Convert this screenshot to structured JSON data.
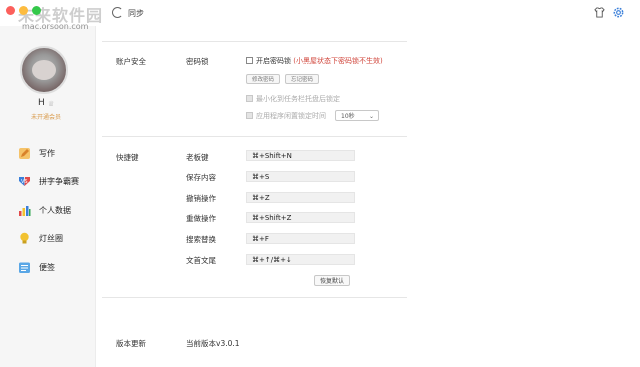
{
  "watermark": {
    "text": "未来软件园",
    "url": "mac.orsoon.com"
  },
  "topbar": {
    "sync_label": "同步"
  },
  "user": {
    "name": "H",
    "membership": "未开通会员"
  },
  "nav": [
    {
      "label": "写作",
      "color": "#e8a33a"
    },
    {
      "label": "拼字争霸赛",
      "color": "#3a7fd9"
    },
    {
      "label": "个人数据",
      "color": "#e24a4a"
    },
    {
      "label": "灯丝圈",
      "color": "#f2c230"
    },
    {
      "label": "便签",
      "color": "#5aa7e6"
    }
  ],
  "security": {
    "section_title": "账户安全",
    "password_lock_label": "密码锁",
    "enable_lock_label": "开启密码锁",
    "enable_lock_note": "(小黑屋状态下密码锁不生效)",
    "change_password_btn": "修改密码",
    "forgot_password_btn": "忘记密码",
    "lock_on_minimize_label": "最小化到任务栏托盘后锁定",
    "idle_lock_label": "应用程序闲置锁定时间",
    "idle_lock_value": "10秒"
  },
  "shortcuts": {
    "section_title": "快捷键",
    "items": [
      {
        "label": "老板键",
        "keys": "⌘+Shift+N"
      },
      {
        "label": "保存内容",
        "keys": "⌘+S"
      },
      {
        "label": "撤销操作",
        "keys": "⌘+Z"
      },
      {
        "label": "重做操作",
        "keys": "⌘+Shift+Z"
      },
      {
        "label": "搜索替换",
        "keys": "⌘+F"
      },
      {
        "label": "文首文尾",
        "keys": "⌘+↑/⌘+↓"
      }
    ],
    "restore_btn": "恢复默认"
  },
  "version": {
    "section_title": "版本更新",
    "current_version": "当前版本v3.0.1"
  }
}
